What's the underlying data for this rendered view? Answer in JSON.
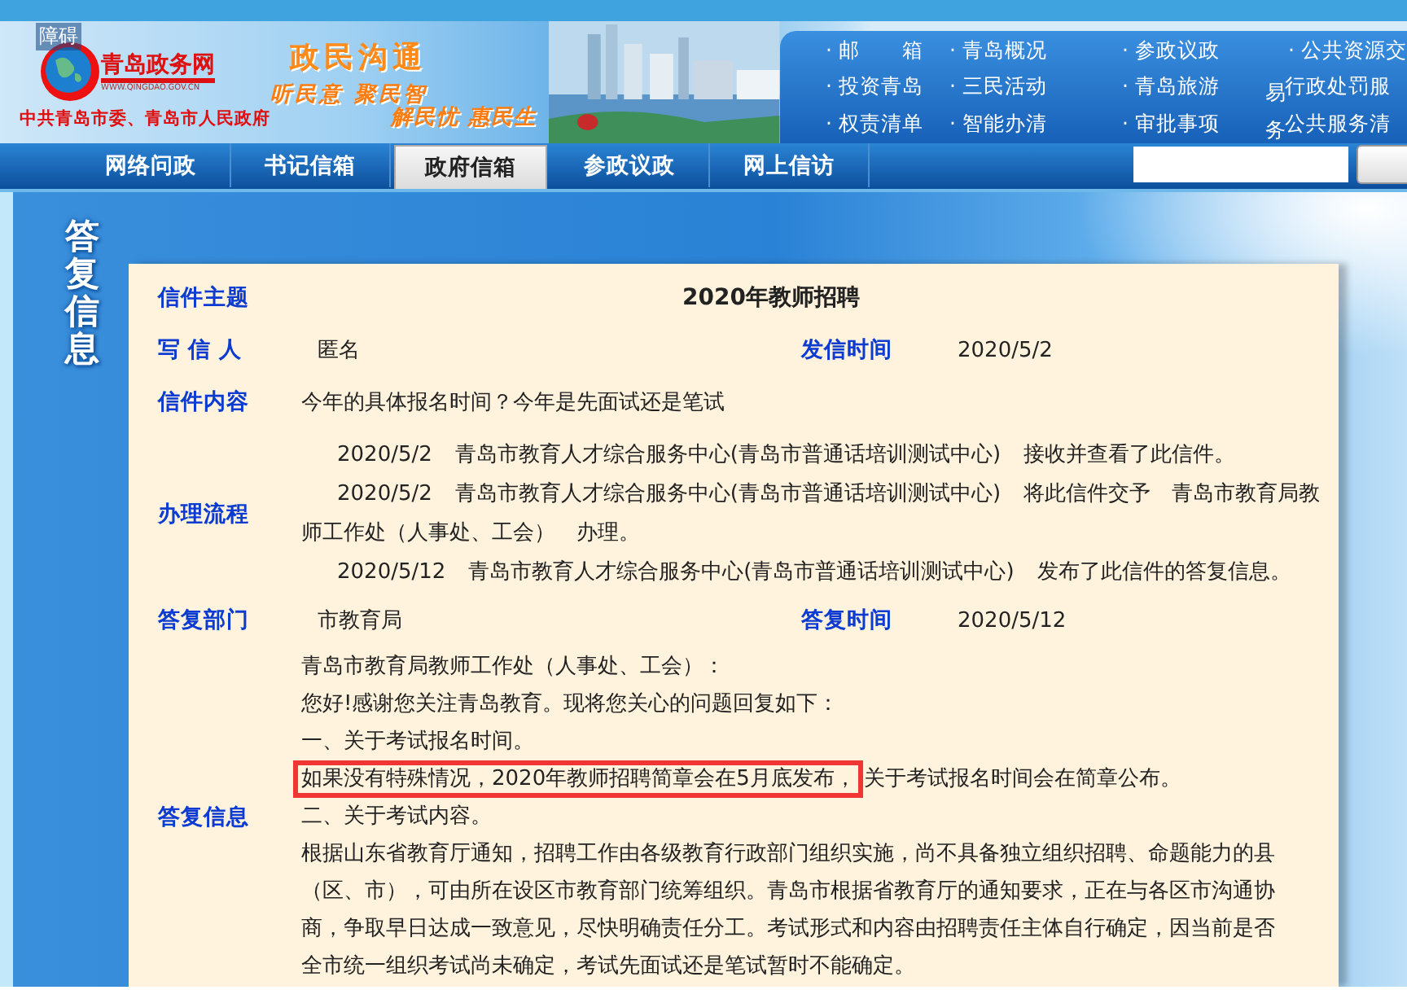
{
  "header": {
    "accessibility_link": "障碍",
    "logo": {
      "name": "青岛政务网",
      "url": "WWW.QINGDAO.GOV.CN",
      "org": "中共青岛市委、青岛市人民政府"
    },
    "slogan": {
      "title": "政民沟通",
      "line_1": "听民意 聚民智",
      "line_2": "解民忧 惠民生"
    },
    "quick_links": [
      {
        "text": "· 邮　　箱"
      },
      {
        "text": "· 青岛概况"
      },
      {
        "text": "· 参政议政"
      },
      {
        "text": "· 公共资源交"
      },
      {
        "text": "· 投资青岛"
      },
      {
        "text": "· 三民活动"
      },
      {
        "text": "· 青岛旅游"
      },
      {
        "text": "行政处罚服",
        "wrap": "易"
      },
      {
        "text": "· 权责清单"
      },
      {
        "text": "· 智能办清"
      },
      {
        "text": "· 审批事项"
      },
      {
        "text": "公共服务清",
        "wrap": "务"
      }
    ]
  },
  "nav": {
    "tabs": [
      {
        "label": "网络问政",
        "selected": false
      },
      {
        "label": "书记信箱",
        "selected": false
      },
      {
        "label": "政府信箱",
        "selected": true
      },
      {
        "label": "参政议政",
        "selected": false
      },
      {
        "label": "网上信访",
        "selected": false
      }
    ]
  },
  "section_title": "答复信息",
  "letter": {
    "subject_label": "信件主题",
    "subject": "2020年教师招聘",
    "sender_label": "写 信 人",
    "sender": "匿名",
    "sent_label": "发信时间",
    "sent": "2020/5/2",
    "content_label": "信件内容",
    "content": "今年的具体报名时间？今年是先面试还是笔试",
    "process_label": "办理流程",
    "process": [
      {
        "date": "2020/5/2",
        "handler": "青岛市教育人才综合服务中心(青岛市普通话培训测试中心)",
        "action": "接收并查看了此信件。"
      },
      {
        "date": "2020/5/2",
        "handler": "青岛市教育人才综合服务中心(青岛市普通话培训测试中心)",
        "action": "将此信件交予　青岛市教育局教师工作处（人事处、工会）　办理。"
      },
      {
        "date": "2020/5/12",
        "handler": "青岛市教育人才综合服务中心(青岛市普通话培训测试中心)",
        "action": "发布了此信件的答复信息。"
      }
    ],
    "dept_label": "答复部门",
    "dept": "市教育局",
    "reply_time_label": "答复时间",
    "reply_time": "2020/5/12",
    "reply_label": "答复信息",
    "reply": [
      [
        {
          "text": "青岛市教育局教师工作处（人事处、工会）：",
          "highlighted": false
        }
      ],
      [
        {
          "text": "您好!感谢您关注青岛教育。现将您关心的问题回复如下：",
          "highlighted": false
        }
      ],
      [
        {
          "text": "一、关于考试报名时间。",
          "highlighted": false
        }
      ],
      [
        {
          "text": "如果没有特殊情况，2020年教师招聘简章会在5月底发布，",
          "highlighted": true
        },
        {
          "text": "关于考试报名时间会在简章公布。",
          "highlighted": false
        }
      ],
      [
        {
          "text": "二、关于考试内容。",
          "highlighted": false
        }
      ],
      [
        {
          "text": "根据山东省教育厅通知，招聘工作由各级教育行政部门组织实施，尚不具备独立组织招聘、命题能力的县（区、市），可由所在设区市教育部门统筹组织。青岛市根据省教育厅的通知要求，正在与各区市沟通协商，争取早日达成一致意见，尽快明确责任分工。考试形式和内容由招聘责任主体自行确定，因当前是否全市统一组织考试尚未确定，考试先面试还是笔试暂时不能确定。",
          "highlighted": false
        }
      ]
    ]
  }
}
